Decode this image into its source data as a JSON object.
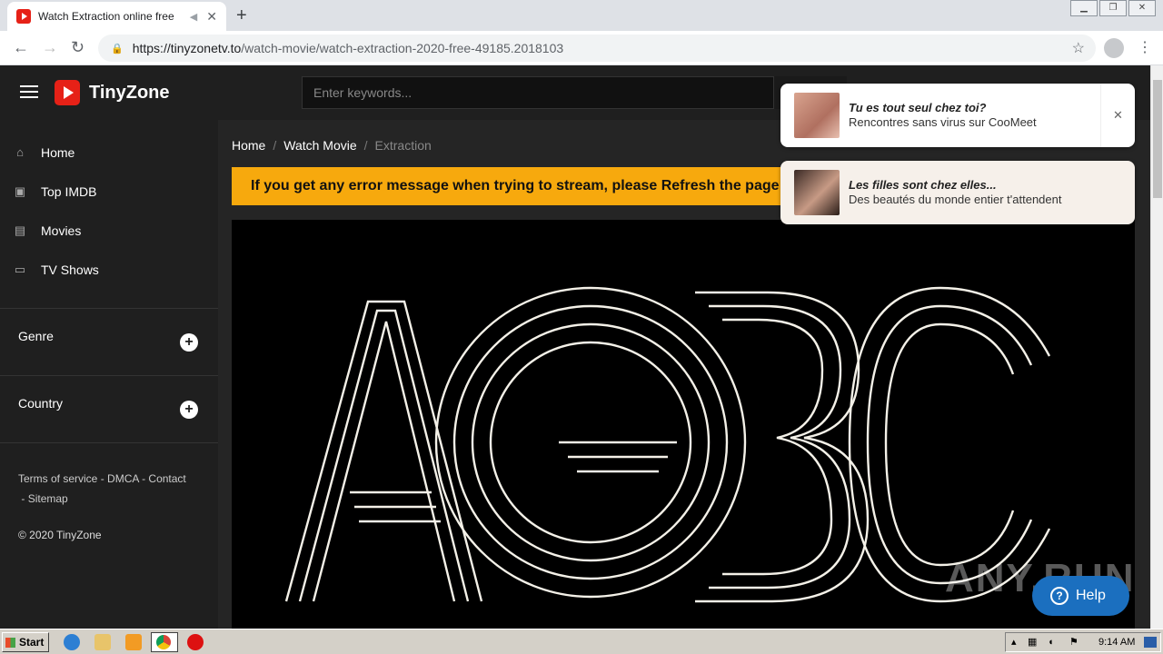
{
  "browser": {
    "tab_title": "Watch Extraction online free",
    "tab_close": "✕",
    "new_tab": "+",
    "url_host": "https://tinyzonetv.to",
    "url_path": "/watch-movie/watch-extraction-2020-free-49185.2018103",
    "back": "←",
    "forward": "→",
    "reload": "↻",
    "star": "☆",
    "menu": "⋮"
  },
  "site": {
    "name": "TinyZone",
    "search_placeholder": "Enter keywords..."
  },
  "sidebar": {
    "items": [
      {
        "label": "Home",
        "icon": "⌂"
      },
      {
        "label": "Top IMDB",
        "icon": "▣"
      },
      {
        "label": "Movies",
        "icon": "▤"
      },
      {
        "label": "TV Shows",
        "icon": "▭"
      }
    ],
    "genre": "Genre",
    "country": "Country",
    "plus": "+",
    "footer": {
      "terms": "Terms of service",
      "dmca": "DMCA",
      "contact": "Contact",
      "sitemap": "Sitemap",
      "sep": "-"
    },
    "copyright": "© 2020 TinyZone"
  },
  "breadcrumb": {
    "home": "Home",
    "watch_movie": "Watch Movie",
    "current": "Extraction",
    "sep": "/"
  },
  "alert": "If you get any error message when trying to stream, please Refresh the page or s",
  "notifications": [
    {
      "title": "Tu es tout seul chez toi?",
      "body": "Rencontres sans virus sur CooMeet",
      "close": "✕"
    },
    {
      "title": "Les filles sont chez elles...",
      "body": "Des beautés du monde entier t'attendent"
    }
  ],
  "help": {
    "label": "Help",
    "q": "?"
  },
  "watermark": "ANY.RUN",
  "taskbar": {
    "start": "Start",
    "clock": "9:14 AM"
  },
  "colors": {
    "accent": "#e62117",
    "alert": "#f7a90d",
    "help": "#1b6fbf"
  }
}
